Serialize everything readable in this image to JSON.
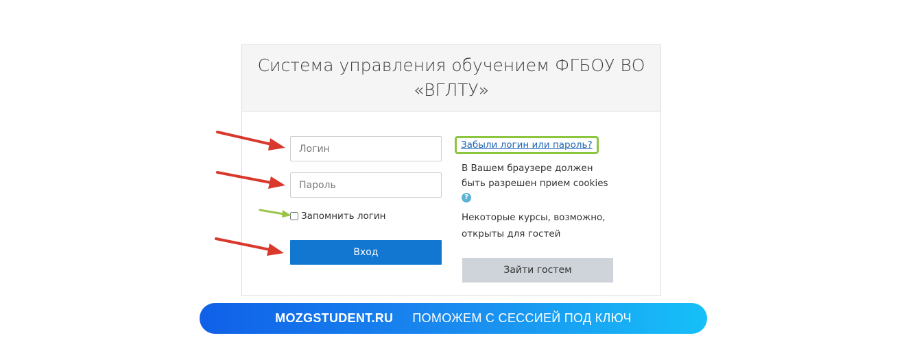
{
  "header": {
    "title": "Система управления обучением ФГБОУ ВО «ВГЛТУ»"
  },
  "form": {
    "username_placeholder": "Логин",
    "username_value": "",
    "password_placeholder": "Пароль",
    "password_value": "",
    "remember_label": "Запомнить логин",
    "remember_checked": false,
    "login_button": "Вход"
  },
  "info": {
    "forgot_link": "Забыли логин или пароль?",
    "cookies_text": "В Вашем браузере должен быть разрешен прием cookies",
    "help_icon": "question-circle-icon",
    "guest_text": "Некоторые курсы, возможно, открыты для гостей",
    "guest_button": "Зайти гостем"
  },
  "banner": {
    "brand": "MOZGSTUDENT.RU",
    "slogan": "ПОМОЖЕМ С СЕССИЕЙ ПОД КЛЮЧ"
  },
  "colors": {
    "primary_button": "#1177d1",
    "guest_button": "#ced4da",
    "link": "#1f66b5",
    "highlight_green": "#8cc63f",
    "arrow_red": "#d9382c",
    "banner_start": "#1060e8",
    "banner_end": "#16c0f8"
  }
}
